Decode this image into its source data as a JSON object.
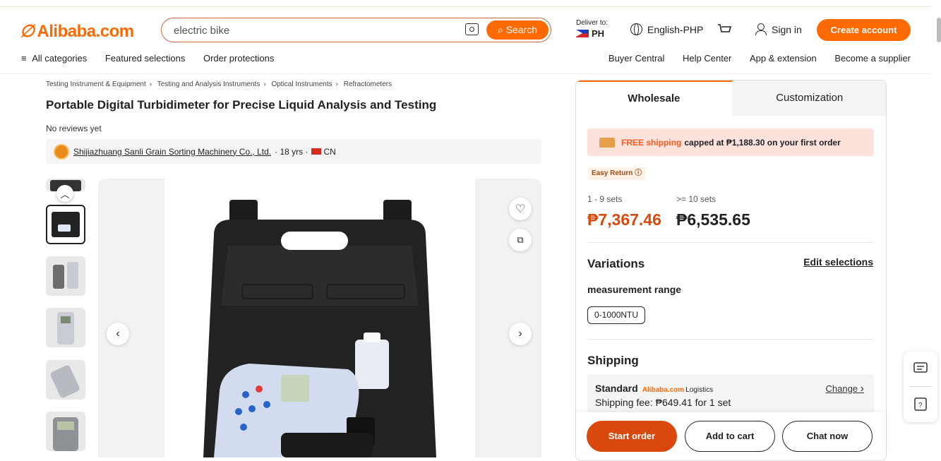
{
  "header": {
    "logo_text": "Alibaba.com",
    "search_value": "electric bike",
    "search_label": "Search",
    "deliver_label": "Deliver to:",
    "deliver_country": "PH",
    "language": "English-PHP",
    "signin": "Sign in",
    "create_account": "Create account"
  },
  "nav": {
    "left": [
      "All categories",
      "Featured selections",
      "Order protections"
    ],
    "right": [
      "Buyer Central",
      "Help Center",
      "App & extension",
      "Become a supplier"
    ]
  },
  "breadcrumb": [
    "Testing Instrument & Equipment",
    "Testing and Analysis Instruments",
    "Optical Instruments",
    "Refractometers"
  ],
  "product": {
    "title": "Portable Digital Turbidimeter for Precise Liquid Analysis and Testing",
    "reviews": "No reviews yet",
    "supplier_name": "Shijiazhuang Sanli Grain Sorting Machinery Co., Ltd.",
    "supplier_years": "· 18 yrs ·",
    "supplier_country": "CN"
  },
  "panel": {
    "tab_wholesale": "Wholesale",
    "tab_customization": "Customization",
    "promo_highlight": "FREE shipping",
    "promo_text": "capped at ₱1,188.30 on your first order",
    "easy_return": "Easy Return ⓘ",
    "tiers": [
      {
        "qty": "1 - 9 sets",
        "price": "₱7,367.46",
        "color": "#d9490e"
      },
      {
        "qty": ">= 10 sets",
        "price": "₱6,535.65",
        "color": "#222222"
      }
    ],
    "variations_title": "Variations",
    "edit_selections": "Edit selections",
    "measurement_label": "measurement range",
    "measurement_value": "0-1000NTU",
    "shipping_title": "Shipping",
    "shipping_method": "Standard",
    "shipping_brand": "Alibaba.com",
    "shipping_logistics": "Logistics",
    "shipping_fee": "Shipping fee: ₱649.41 for 1 set",
    "shipping_change": "Change"
  },
  "footer": {
    "start_order": "Start order",
    "add_to_cart": "Add to cart",
    "chat_now": "Chat now"
  },
  "colors": {
    "accent": "#ff6a00",
    "primary_button": "#d9490e"
  }
}
